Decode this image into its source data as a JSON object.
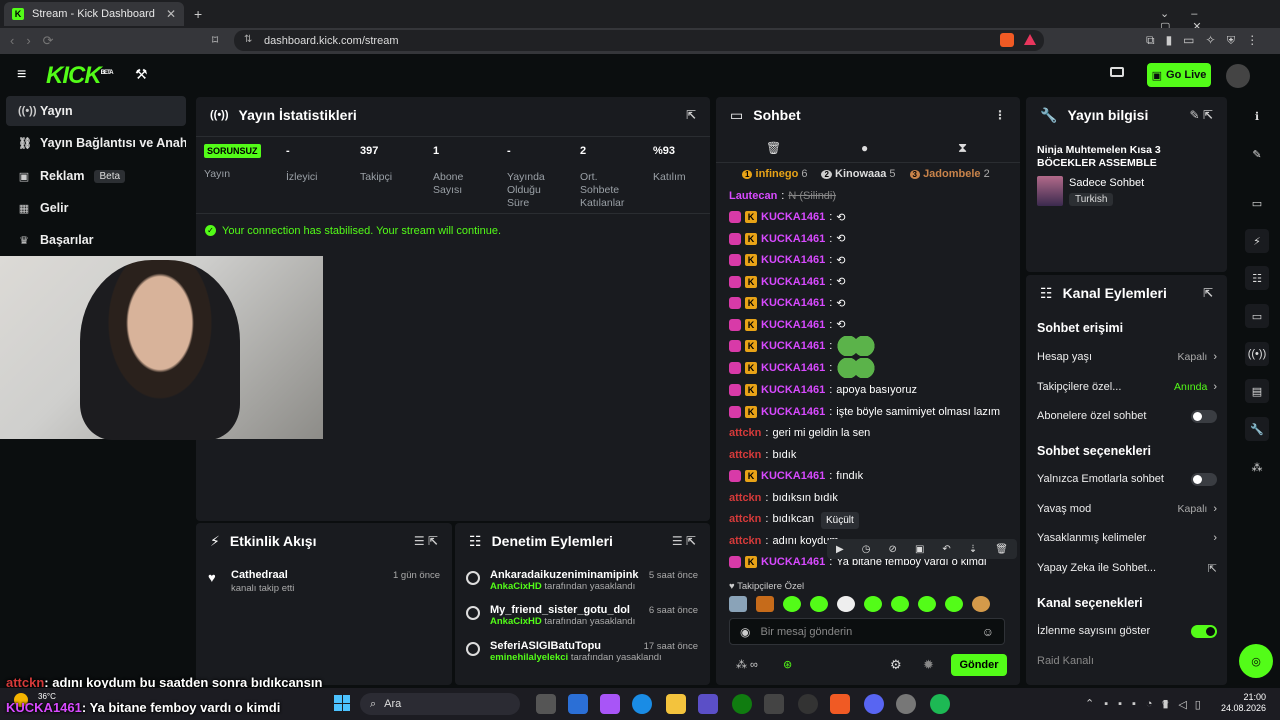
{
  "browser": {
    "tab_title": "Stream - Kick Dashboard",
    "tab_fav": "K",
    "tab_close": "✕",
    "new_tab": "+",
    "url": "dashboard.kick.com/stream"
  },
  "header": {
    "logo": "KICK",
    "logo_sup": "BETA",
    "go_live": "Go Live"
  },
  "sidebar": {
    "items": [
      {
        "label": "Yayın",
        "icon": "stream-icon",
        "glyph": "((•))"
      },
      {
        "label": "Yayın Bağlantısı ve Anahtarı",
        "icon": "link-icon",
        "glyph": "⛓"
      },
      {
        "label": "Reklam",
        "icon": "ad-icon",
        "glyph": "▣",
        "badge": "Beta"
      },
      {
        "label": "Gelir",
        "icon": "money-icon",
        "glyph": "▦"
      },
      {
        "label": "Başarılar",
        "icon": "trophy-icon",
        "glyph": "🏆"
      }
    ]
  },
  "stats": {
    "title": "Yayın İstatistikleri",
    "status_badge": "SORUNSUZ",
    "items": [
      {
        "value": "",
        "label": "Yayın"
      },
      {
        "value": "-",
        "label": "İzleyici"
      },
      {
        "value": "397",
        "label": "Takipçi"
      },
      {
        "value": "1",
        "label": "Abone Sayısı"
      },
      {
        "value": "-",
        "label": "Yayında Olduğu Süre"
      },
      {
        "value": "2",
        "label": "Ort. Sohbete Katılanlar"
      },
      {
        "value": "%93",
        "label": "Katılım"
      }
    ],
    "notice": "Your connection has stabilised. Your stream will continue."
  },
  "activity": {
    "title": "Etkinlik Akışı",
    "items": [
      {
        "name": "Cathedraal",
        "sub": "kanalı takip etti",
        "time": "1 gün önce"
      }
    ]
  },
  "moderation": {
    "title": "Denetim Eylemleri",
    "items": [
      {
        "name": "Ankaradaikuzeniminamipink",
        "by": "AnkaCixHD",
        "suffix": "tarafından yasaklandı",
        "time": "5 saat önce"
      },
      {
        "name": "My_friend_sister_gotu_dol",
        "by": "AnkaCixHD",
        "suffix": "tarafından yasaklandı",
        "time": "6 saat önce"
      },
      {
        "name": "SeferiASIGIBatuTopu",
        "by": "eminehilalyelekci",
        "suffix": "tarafından yasaklandı",
        "time": "17 saat önce"
      }
    ]
  },
  "chat": {
    "title": "Sohbet",
    "top": [
      {
        "rank": "1",
        "name": "infinego",
        "count": "6"
      },
      {
        "rank": "2",
        "name": "Kinowaaa",
        "count": "5"
      },
      {
        "rank": "3",
        "name": "Jadombele",
        "count": "2"
      }
    ],
    "deleted_user": "Lautecan",
    "deleted_text": "N (Silindi)",
    "messages": [
      {
        "user": "KUCKA1461",
        "text": "⟲",
        "kind": "k"
      },
      {
        "user": "KUCKA1461",
        "text": "⟲",
        "kind": "k"
      },
      {
        "user": "KUCKA1461",
        "text": "⟲",
        "kind": "k"
      },
      {
        "user": "KUCKA1461",
        "text": "⟲",
        "kind": "k"
      },
      {
        "user": "KUCKA1461",
        "text": "⟲",
        "kind": "k"
      },
      {
        "user": "KUCKA1461",
        "text": "⟲",
        "kind": "k"
      },
      {
        "user": "KUCKA1461",
        "text": "",
        "kind": "k",
        "emote": true
      },
      {
        "user": "KUCKA1461",
        "text": "",
        "kind": "k",
        "emote": true
      },
      {
        "user": "KUCKA1461",
        "text": "apoya basıyoruz",
        "kind": "k"
      },
      {
        "user": "KUCKA1461",
        "text": "işte böyle samimiyet olması lazım",
        "kind": "k"
      },
      {
        "user": "attckn",
        "text": "geri mi geldin la sen",
        "kind": "a"
      },
      {
        "user": "attckn",
        "text": "bıdık",
        "kind": "a"
      },
      {
        "user": "KUCKA1461",
        "text": "fındık",
        "kind": "k"
      },
      {
        "user": "attckn",
        "text": "bıdıksın bıdık",
        "kind": "a"
      },
      {
        "user": "attckn",
        "text": "bıdıkcan",
        "kind": "a"
      },
      {
        "user": "attckn",
        "text": "adını koydum",
        "kind": "a"
      },
      {
        "user": "KUCKA1461",
        "text": "Ya bitane femboy vardı o kimdi",
        "kind": "k"
      }
    ],
    "tooltip": "Küçült",
    "followers_label": "Takipçilere Özel",
    "input_placeholder": "Bir mesaj gönderin",
    "send": "Gönder"
  },
  "stream_info": {
    "title": "Yayın bilgisi",
    "stream_title": "Ninja Muhtemelen Kısa 3 BÖCEKLER ASSEMBLE",
    "category": "Sadece Sohbet",
    "language": "Turkish"
  },
  "channel_actions": {
    "title": "Kanal Eylemleri",
    "chat_access": "Sohbet erişimi",
    "account_age": "Hesap yaşı",
    "account_age_val": "Kapalı",
    "followers_only": "Takipçilere özel...",
    "followers_only_val": "Anında",
    "subs_only": "Abonelere özel sohbet",
    "chat_options": "Sohbet seçenekleri",
    "emote_only": "Yalnızca Emotlarla sohbet",
    "slow_mode": "Yavaş mod",
    "slow_mode_val": "Kapalı",
    "banned_words": "Yasaklanmış kelimeler",
    "ai_chat": "Yapay Zeka ile Sohbet...",
    "channel_options": "Kanal seçenekleri",
    "show_viewers": "İzlenme sayısını göster",
    "raid": "Raid Kanalı"
  },
  "overlay": {
    "line1_user": "attckn",
    "line1_text": ": adını koydum bu saatden sonra bıdıkcansın",
    "line2_user": "KUCKA1461",
    "line2_text": ": Ya bitane femboy vardı o kimdi"
  },
  "taskbar": {
    "weather": "36°C",
    "weather_sub": "Güneşli",
    "search": "Ara",
    "time": "21:00",
    "date": "24.08.2026"
  },
  "colors": {
    "accent": "#53fc18",
    "panel": "#191b1f",
    "bg": "#0b0e0f"
  }
}
